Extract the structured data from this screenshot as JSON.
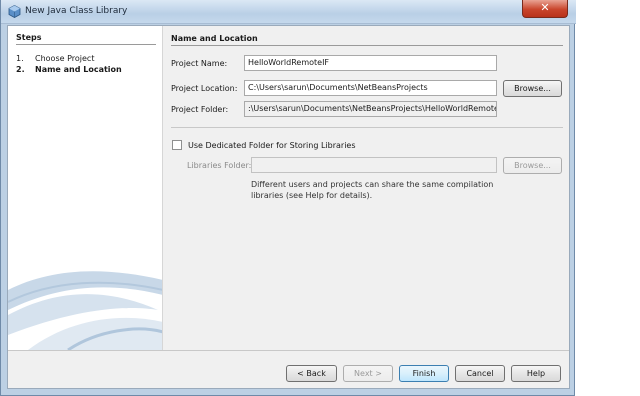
{
  "window": {
    "title": "New Java Class Library",
    "close_glyph": "✕"
  },
  "steps": {
    "title": "Steps",
    "items": [
      {
        "num": "1.",
        "label": "Choose Project"
      },
      {
        "num": "2.",
        "label": "Name and Location"
      }
    ]
  },
  "form": {
    "section_title": "Name and Location",
    "project_name_label": "Project Name:",
    "project_name_value": "HelloWorldRemoteIF",
    "project_location_label": "Project Location:",
    "project_location_value": "C:\\Users\\sarun\\Documents\\NetBeansProjects",
    "browse_label": "Browse...",
    "project_folder_label": "Project Folder:",
    "project_folder_value": ":\\Users\\sarun\\Documents\\NetBeansProjects\\HelloWorldRemoteIF",
    "dedicated_folder_label": "Use Dedicated Folder for Storing Libraries",
    "libraries_folder_label": "Libraries Folder:",
    "libraries_folder_value": "",
    "libraries_browse_label": "Browse...",
    "help_line1": "Different users and projects can share the same compilation",
    "help_line2": "libraries (see Help for details)."
  },
  "buttons": {
    "back": "< Back",
    "next": "Next >",
    "finish": "Finish",
    "cancel": "Cancel",
    "help": "Help"
  },
  "colors": {
    "accent": "#3c7fb1",
    "close": "#c9452c",
    "swoosh": "#b8cde0"
  }
}
